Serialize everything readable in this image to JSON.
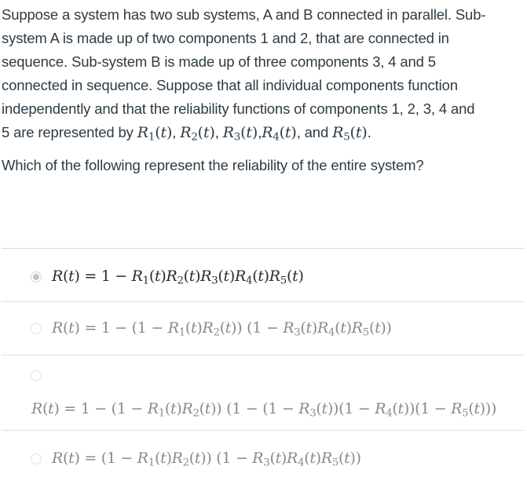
{
  "question": {
    "paragraph_lines": [
      "Suppose a system has two sub systems, A and B connected in parallel.  Sub-",
      "system A is made up of two components 1 and 2, that are connected in",
      "sequence. Sub-system B is made up of three components 3, 4 and 5",
      "connected in sequence.   Suppose that all individual components function",
      "independently and that the reliability functions of components 1, 2, 3, 4 and"
    ],
    "last_line_prefix": "5 are represented by ",
    "functions": [
      "R₁(t)",
      "R₂(t)",
      "R₃(t)",
      "R₄(t)",
      "R₅(t)"
    ],
    "sep_comma": ", ",
    "sep_comma_tight": ",",
    "and_text": ", and ",
    "period": ".",
    "prompt": "Which of the following represent the reliability of the entire system?"
  },
  "answers": [
    {
      "id": "option-1",
      "selected": true,
      "formula": "R(t) = 1 − R₁(t)R₂(t)R₃(t)R₄(t)R₅(t)"
    },
    {
      "id": "option-2",
      "selected": false,
      "formula": "R(t) = 1 − (1 − R₁(t)R₂(t)) (1 − R₃(t)R₄(t)R₅(t))"
    },
    {
      "id": "option-3",
      "selected": false,
      "formula": "R(t) = 1 − (1 − R₁(t)R₂(t)) (1 − (1 − R₃(t))(1 − R₄(t))(1 − R₅(t)))"
    },
    {
      "id": "option-4",
      "selected": false,
      "formula": "R(t) = (1 − R₁(t)R₂(t)) (1 − R₃(t)R₄(t)R₅(t))"
    }
  ],
  "colors": {
    "text": "#2d3b45",
    "selected_formula": "#2b2b2b",
    "unselected_formula": "#8a8a8a",
    "divider": "#e0e0e0",
    "radio_dot": "#c4c4c4"
  }
}
